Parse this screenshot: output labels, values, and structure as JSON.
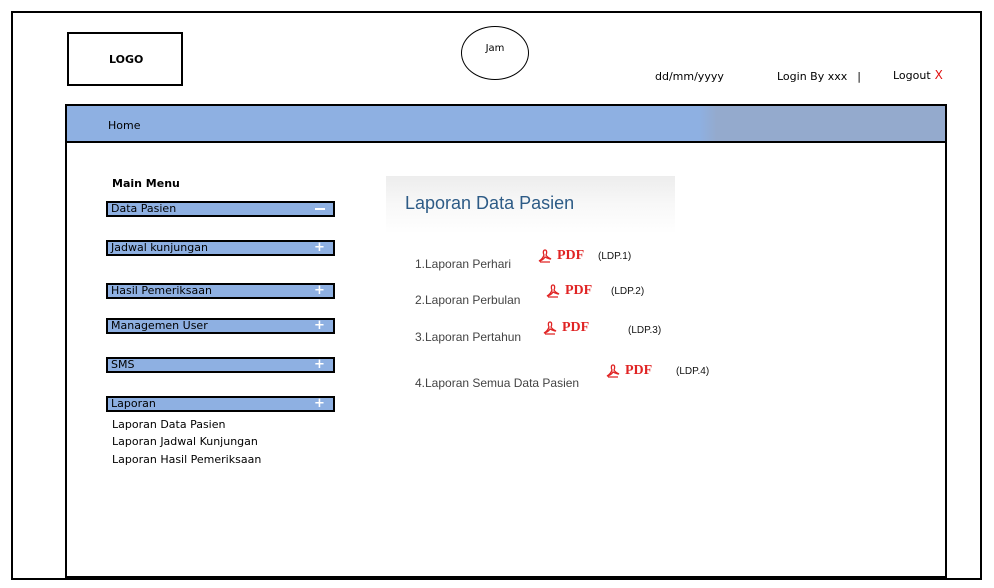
{
  "header": {
    "logo": "LOGO",
    "clock": "Jam",
    "date": "dd/mm/yyyy",
    "login_label": "Login By xxx",
    "separator": "|",
    "logout_label": "Logout",
    "logout_icon": "X"
  },
  "nav": {
    "home": "Home"
  },
  "sidebar": {
    "title": "Main Menu",
    "items": [
      {
        "label": "Data Pasien",
        "icon": "minus-icon"
      },
      {
        "label": "Jadwal kunjungan",
        "icon": "plus-icon"
      },
      {
        "label": "Hasil Pemeriksaan",
        "icon": "plus-icon"
      },
      {
        "label": "Managemen User",
        "icon": "plus-icon"
      },
      {
        "label": "SMS",
        "icon": "plus-icon"
      },
      {
        "label": "Laporan",
        "icon": "plus-icon"
      }
    ],
    "sub_items": [
      "Laporan Data Pasien",
      "Laporan Jadwal Kunjungan",
      "Laporan Hasil Pemeriksaan"
    ]
  },
  "content": {
    "title": "Laporan Data Pasien",
    "reports": [
      {
        "label": "1.Laporan Perhari",
        "pdf": "PDF",
        "code": "(LDP.1)"
      },
      {
        "label": "2.Laporan Perbulan",
        "pdf": "PDF",
        "code": "(LDP.2)"
      },
      {
        "label": "3.Laporan Pertahun",
        "pdf": "PDF",
        "code": "(LDP.3)"
      },
      {
        "label": "4.Laporan Semua Data Pasien",
        "pdf": "PDF",
        "code": "(LDP.4)"
      }
    ]
  },
  "colors": {
    "menu_fill": "#8eb0e2",
    "title_blue": "#2d5b86",
    "pdf_red": "#e02424",
    "logout_red": "#e01010"
  }
}
